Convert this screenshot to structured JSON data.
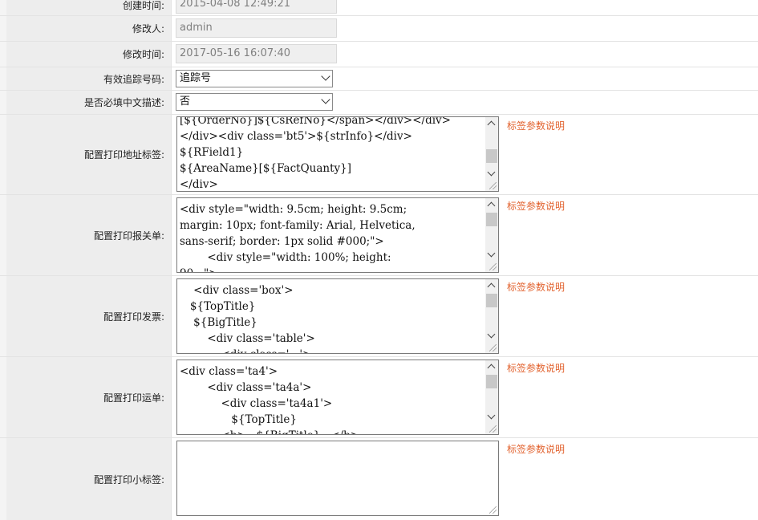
{
  "rows": {
    "created_time": {
      "label": "创建时间:",
      "value": "2015-04-08 12:49:21"
    },
    "modifier": {
      "label": "修改人:",
      "value": "admin"
    },
    "modified_time": {
      "label": "修改时间:",
      "value": "2017-05-16 16:07:40"
    },
    "tracking_number": {
      "label": "有效追踪号码:",
      "selected": "追踪号"
    },
    "chinese_desc_required": {
      "label": "是否必填中文描述:",
      "selected": "否"
    },
    "address_label": {
      "label": "配置打印地址标签:",
      "content": "[${OrderNo}]${CsRefNo}</span></div></div>\n</div><div class='bt5'>${strInfo}</div>\n${RField1}\n${AreaName}[${FactQuanty}]\n</div>",
      "help": "标签参数说明"
    },
    "customs_form": {
      "label": "配置打印报关单:",
      "content": "<div style=\"width: 9.5cm; height: 9.5cm;\nmargin: 10px; font-family: Arial, Helvetica,\nsans-serif; border: 1px solid #000;\">\n        <div style=\"width: 100%; height:\n90...\">",
      "help": "标签参数说明"
    },
    "invoice": {
      "label": "配置打印发票:",
      "content": "    <div class='box'>\n   ${TopTitle}\n    ${BigTitle}\n        <div class='table'>\n            <div class='...'>",
      "help": "标签参数说明"
    },
    "waybill": {
      "label": "配置打印运单:",
      "content": "<div class='ta4'>\n        <div class='ta4a'>\n            <div class='ta4a1'>\n               ${TopTitle}\n            <b>...${BigTitle}...</b>",
      "help": "标签参数说明"
    },
    "small_label": {
      "label": "配置打印小标签:",
      "content": "",
      "help": "标签参数说明"
    }
  }
}
